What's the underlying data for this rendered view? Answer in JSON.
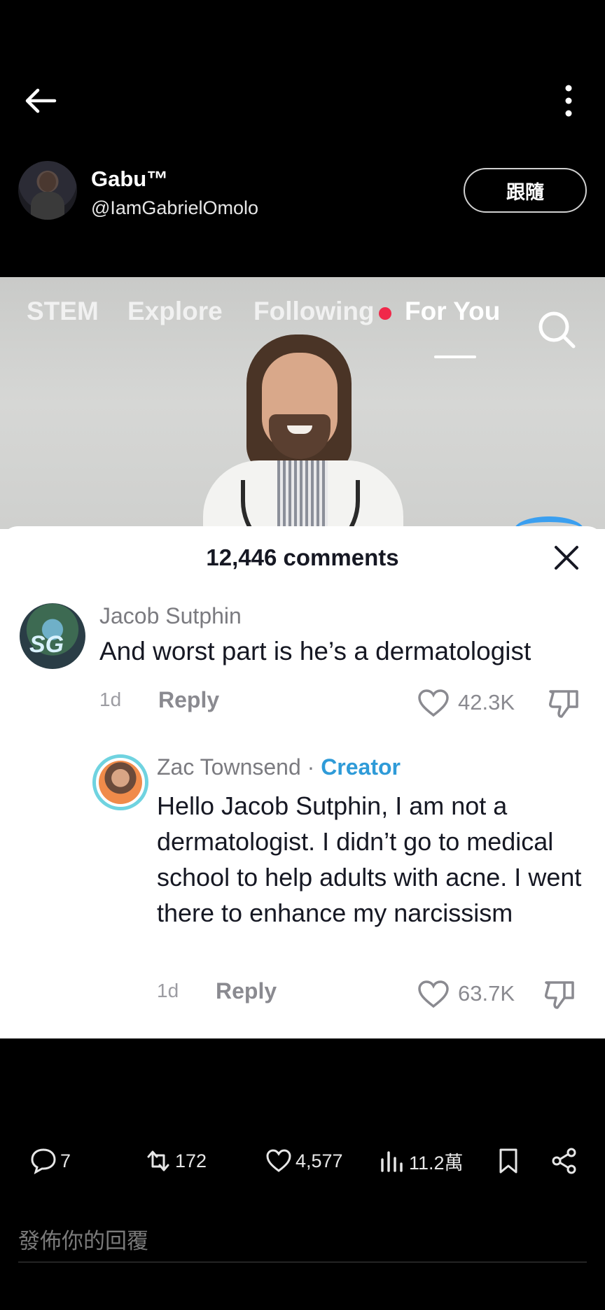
{
  "author": {
    "name": "Gabu™",
    "handle": "@IamGabrielOmolo",
    "follow_label": "跟隨"
  },
  "media": {
    "tabs": [
      "STEM",
      "Explore",
      "Following",
      "For You"
    ],
    "active_tab": "For You",
    "comments_sheet": {
      "title": "12,446 comments",
      "comments": [
        {
          "author": "Jacob Sutphin",
          "text": "And worst part is he’s a dermatologist",
          "time": "1d",
          "reply_label": "Reply",
          "likes": "42.3K"
        },
        {
          "author": "Zac Townsend",
          "separator": " · ",
          "badge": "Creator",
          "text": "Hello Jacob Sutphin, I am not a dermatologist. I didn’t go to medical school to help adults with acne. I went there to enhance my narcissism",
          "time": "1d",
          "reply_label": "Reply",
          "likes": "63.7K"
        }
      ]
    }
  },
  "actions": {
    "replies": "7",
    "reposts": "172",
    "likes": "4,577",
    "views": "11.2萬"
  },
  "reply_box": {
    "placeholder": "發佈你的回覆"
  },
  "colors": {
    "creator_badge": "#2f9bd8",
    "notification_dot": "#f0284a"
  }
}
